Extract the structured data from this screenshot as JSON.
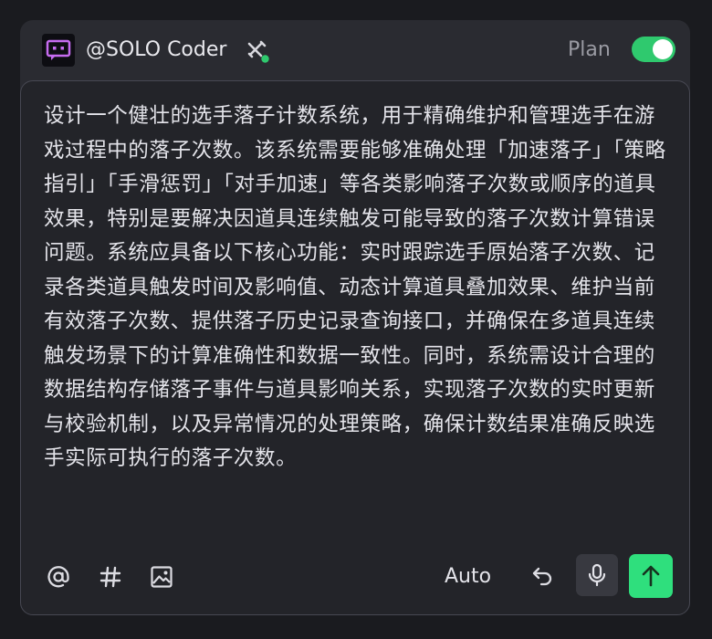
{
  "header": {
    "agent_name": "@SOLO Coder",
    "agent_avatar_icon": "terminal-chat-icon",
    "tools_icon": "tools-icon",
    "status_dot_color": "#2fc96e",
    "plan_label": "Plan",
    "plan_enabled": true
  },
  "editor": {
    "prompt": "设计一个健壮的选手落子计数系统，用于精确维护和管理选手在游戏过程中的落子次数。该系统需要能够准确处理「加速落子」「策略指引」「手滑惩罚」「对手加速」等各类影响落子次数或顺序的道具效果，特别是要解决因道具连续触发可能导致的落子次数计算错误问题。系统应具备以下核心功能：实时跟踪选手原始落子次数、记录各类道具触发时间及影响值、动态计算道具叠加效果、维护当前有效落子次数、提供落子历史记录查询接口，并确保在多道具连续触发场景下的计算准确性和数据一致性。同时，系统需设计合理的数据结构存储落子事件与道具影响关系，实现落子次数的实时更新与校验机制，以及异常情况的处理策略，确保计数结果准确反映选手实际可执行的落子次数。"
  },
  "toolbar": {
    "mention_icon": "at-icon",
    "hash_icon": "hash-icon",
    "image_icon": "image-icon",
    "mode_label": "Auto",
    "undo_icon": "undo-icon",
    "mic_icon": "microphone-icon",
    "send_icon": "send-arrow-icon",
    "accent_color": "#2fdf7d"
  }
}
